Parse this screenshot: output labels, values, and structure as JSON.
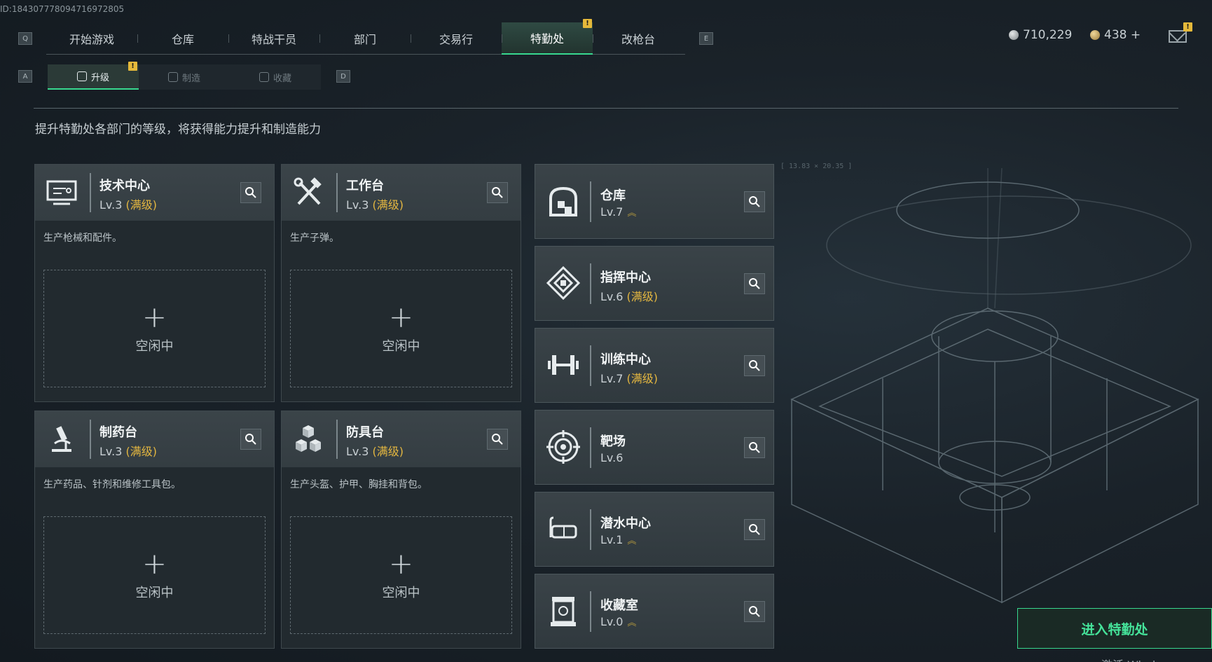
{
  "uid": "ID:18430777809471697280​5",
  "nav": {
    "hotkey_left": "Q",
    "hotkey_right": "E",
    "tabs": [
      "开始游戏",
      "仓库",
      "特战干员",
      "部门",
      "交易行",
      "特勤处",
      "改枪台"
    ],
    "badge": "!"
  },
  "currency": {
    "silver": "710,229",
    "gold": "438 +"
  },
  "subnav": {
    "hotkey_left": "A",
    "hotkey_right": "D",
    "tabs": [
      "升级",
      "制造",
      "收藏"
    ]
  },
  "description": "提升特勤处各部门的等级，将获得能力提升和制造能力",
  "coords": "[ 13.83 × 20.35 ]",
  "production": [
    {
      "name": "技术中心",
      "level": "Lv.3",
      "max": "(满级)",
      "desc": "生产枪械和配件。",
      "slot_plus": "+",
      "slot_status": "空闲中"
    },
    {
      "name": "工作台",
      "level": "Lv.3",
      "max": "(满级)",
      "desc": "生产子弹。",
      "slot_plus": "+",
      "slot_status": "空闲中"
    },
    {
      "name": "制药台",
      "level": "Lv.3",
      "max": "(满级)",
      "desc": "生产药品、针剂和维修工具包。",
      "slot_plus": "+",
      "slot_status": "空闲中"
    },
    {
      "name": "防具台",
      "level": "Lv.3",
      "max": "(满级)",
      "desc": "生产头盔、护甲、胸挂和背包。",
      "slot_plus": "+",
      "slot_status": "空闲中"
    }
  ],
  "facilities": [
    {
      "name": "仓库",
      "level": "Lv.7",
      "max": "",
      "chev": "︽"
    },
    {
      "name": "指挥中心",
      "level": "Lv.6",
      "max": "(满级)",
      "chev": ""
    },
    {
      "name": "训练中心",
      "level": "Lv.7",
      "max": "(满级)",
      "chev": ""
    },
    {
      "name": "靶场",
      "level": "Lv.6",
      "max": "",
      "chev": ""
    },
    {
      "name": "潜水中心",
      "level": "Lv.1",
      "max": "",
      "chev": "︽"
    },
    {
      "name": "收藏室",
      "level": "Lv.0",
      "max": "",
      "chev": "︽"
    }
  ],
  "enter_button": "进入特勤处",
  "activate_text": "激活 Wind",
  "colors": {
    "accent": "#38d88f",
    "max_level": "#e3b640",
    "badge": "#e5b93a"
  }
}
